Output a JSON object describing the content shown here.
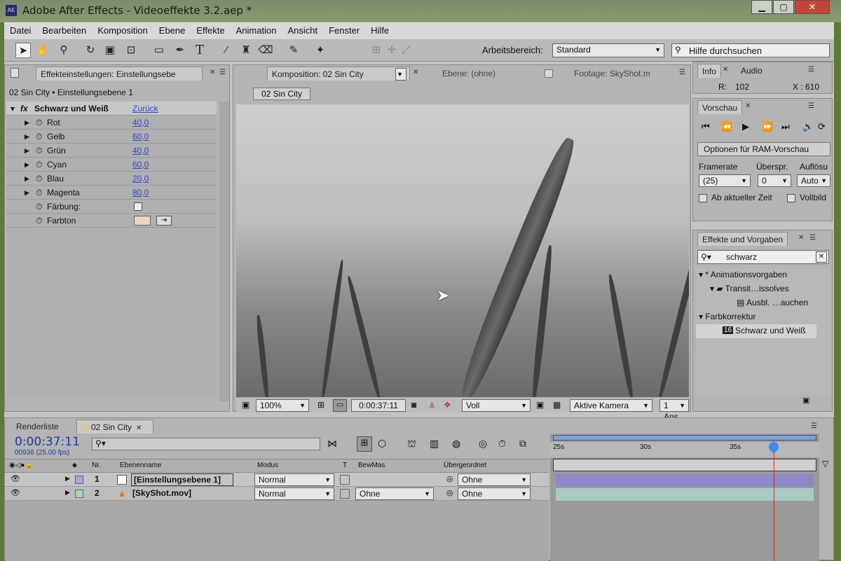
{
  "window": {
    "title": "Adobe After Effects - Videoeffekte 3.2.aep *",
    "icon": "AE"
  },
  "menu": [
    "Datei",
    "Bearbeiten",
    "Komposition",
    "Ebene",
    "Effekte",
    "Animation",
    "Ansicht",
    "Fenster",
    "Hilfe"
  ],
  "toolbar": {
    "workspace_label": "Arbeitsbereich:",
    "workspace_value": "Standard",
    "search_placeholder": "Hilfe durchsuchen"
  },
  "effects_panel": {
    "tab": "Effekteinstellungen: Einstellungsebe",
    "breadcrumb": "02 Sin City • Einstellungsebene 1",
    "effect_name": "Schwarz und Weiß",
    "reset": "Zurück",
    "params": [
      {
        "label": "Rot",
        "value": "40,0"
      },
      {
        "label": "Gelb",
        "value": "60,0"
      },
      {
        "label": "Grün",
        "value": "40,0"
      },
      {
        "label": "Cyan",
        "value": "60,0"
      },
      {
        "label": "Blau",
        "value": "20,0"
      },
      {
        "label": "Magenta",
        "value": "80,0"
      }
    ],
    "tint_label": "Färbung:",
    "hue_label": "Farbton",
    "hue_color": "#e8d8b8"
  },
  "comp_panel": {
    "tab_comp": "Komposition: 02 Sin City",
    "tab_layer": "Ebene: (ohne)",
    "tab_footage": "Footage: SkyShot.m",
    "comp_button": "02 Sin City",
    "zoom": "100%",
    "timecode": "0:00:37:11",
    "quality": "Voll",
    "camera": "Aktive Kamera",
    "views": "1 Ans"
  },
  "info_panel": {
    "tab_info": "Info",
    "tab_audio": "Audio",
    "r_label": "R:",
    "r_value": "102",
    "x_label": "X : 610"
  },
  "preview_panel": {
    "tab": "Vorschau",
    "ram_options": "Optionen für RAM-Vorschau",
    "framerate_label": "Framerate",
    "skip_label": "Überspr.",
    "res_label": "Auflösu",
    "framerate_value": "(25)",
    "skip_value": "0",
    "res_value": "Auto",
    "from_current": "Ab aktueller Zeit",
    "fullscreen": "Vollbild"
  },
  "effects_presets_panel": {
    "tab": "Effekte und Vorgaben",
    "search_value": "schwarz",
    "tree": [
      {
        "label": "* Animationsvorgaben",
        "level": 0
      },
      {
        "label": "Transit…issolves",
        "level": 1
      },
      {
        "label": "Ausbl. …auchen",
        "level": 2
      },
      {
        "label": "Farbkorrektur",
        "level": 0
      },
      {
        "label": "Schwarz und Weiß",
        "level": 1
      }
    ]
  },
  "timeline": {
    "tab_render": "Renderliste",
    "tab_comp": "02 Sin City",
    "timecode": "0:00:37:11",
    "frame_info": "00936 (25.00 fps)",
    "columns": {
      "nr": "Nr.",
      "name": "Ebenenname",
      "mode": "Modus",
      "t": "T",
      "trkmat": "BewMas",
      "parent": "Übergeordnet"
    },
    "ruler": [
      "25s",
      "30s",
      "35s"
    ],
    "current_time_fraction": 0.83,
    "layers": [
      {
        "nr": "1",
        "name": "[Einstellungsebene 1]",
        "mode": "Normal",
        "trkmat": "",
        "parent": "Ohne",
        "label_color": "#a9a4d9",
        "bar_color": "#8d88c6"
      },
      {
        "nr": "2",
        "name": "[SkyShot.mov]",
        "mode": "Normal",
        "trkmat": "Ohne",
        "parent": "Ohne",
        "label_color": "#a9d0c6",
        "bar_color": "#a6cbc2"
      }
    ]
  }
}
